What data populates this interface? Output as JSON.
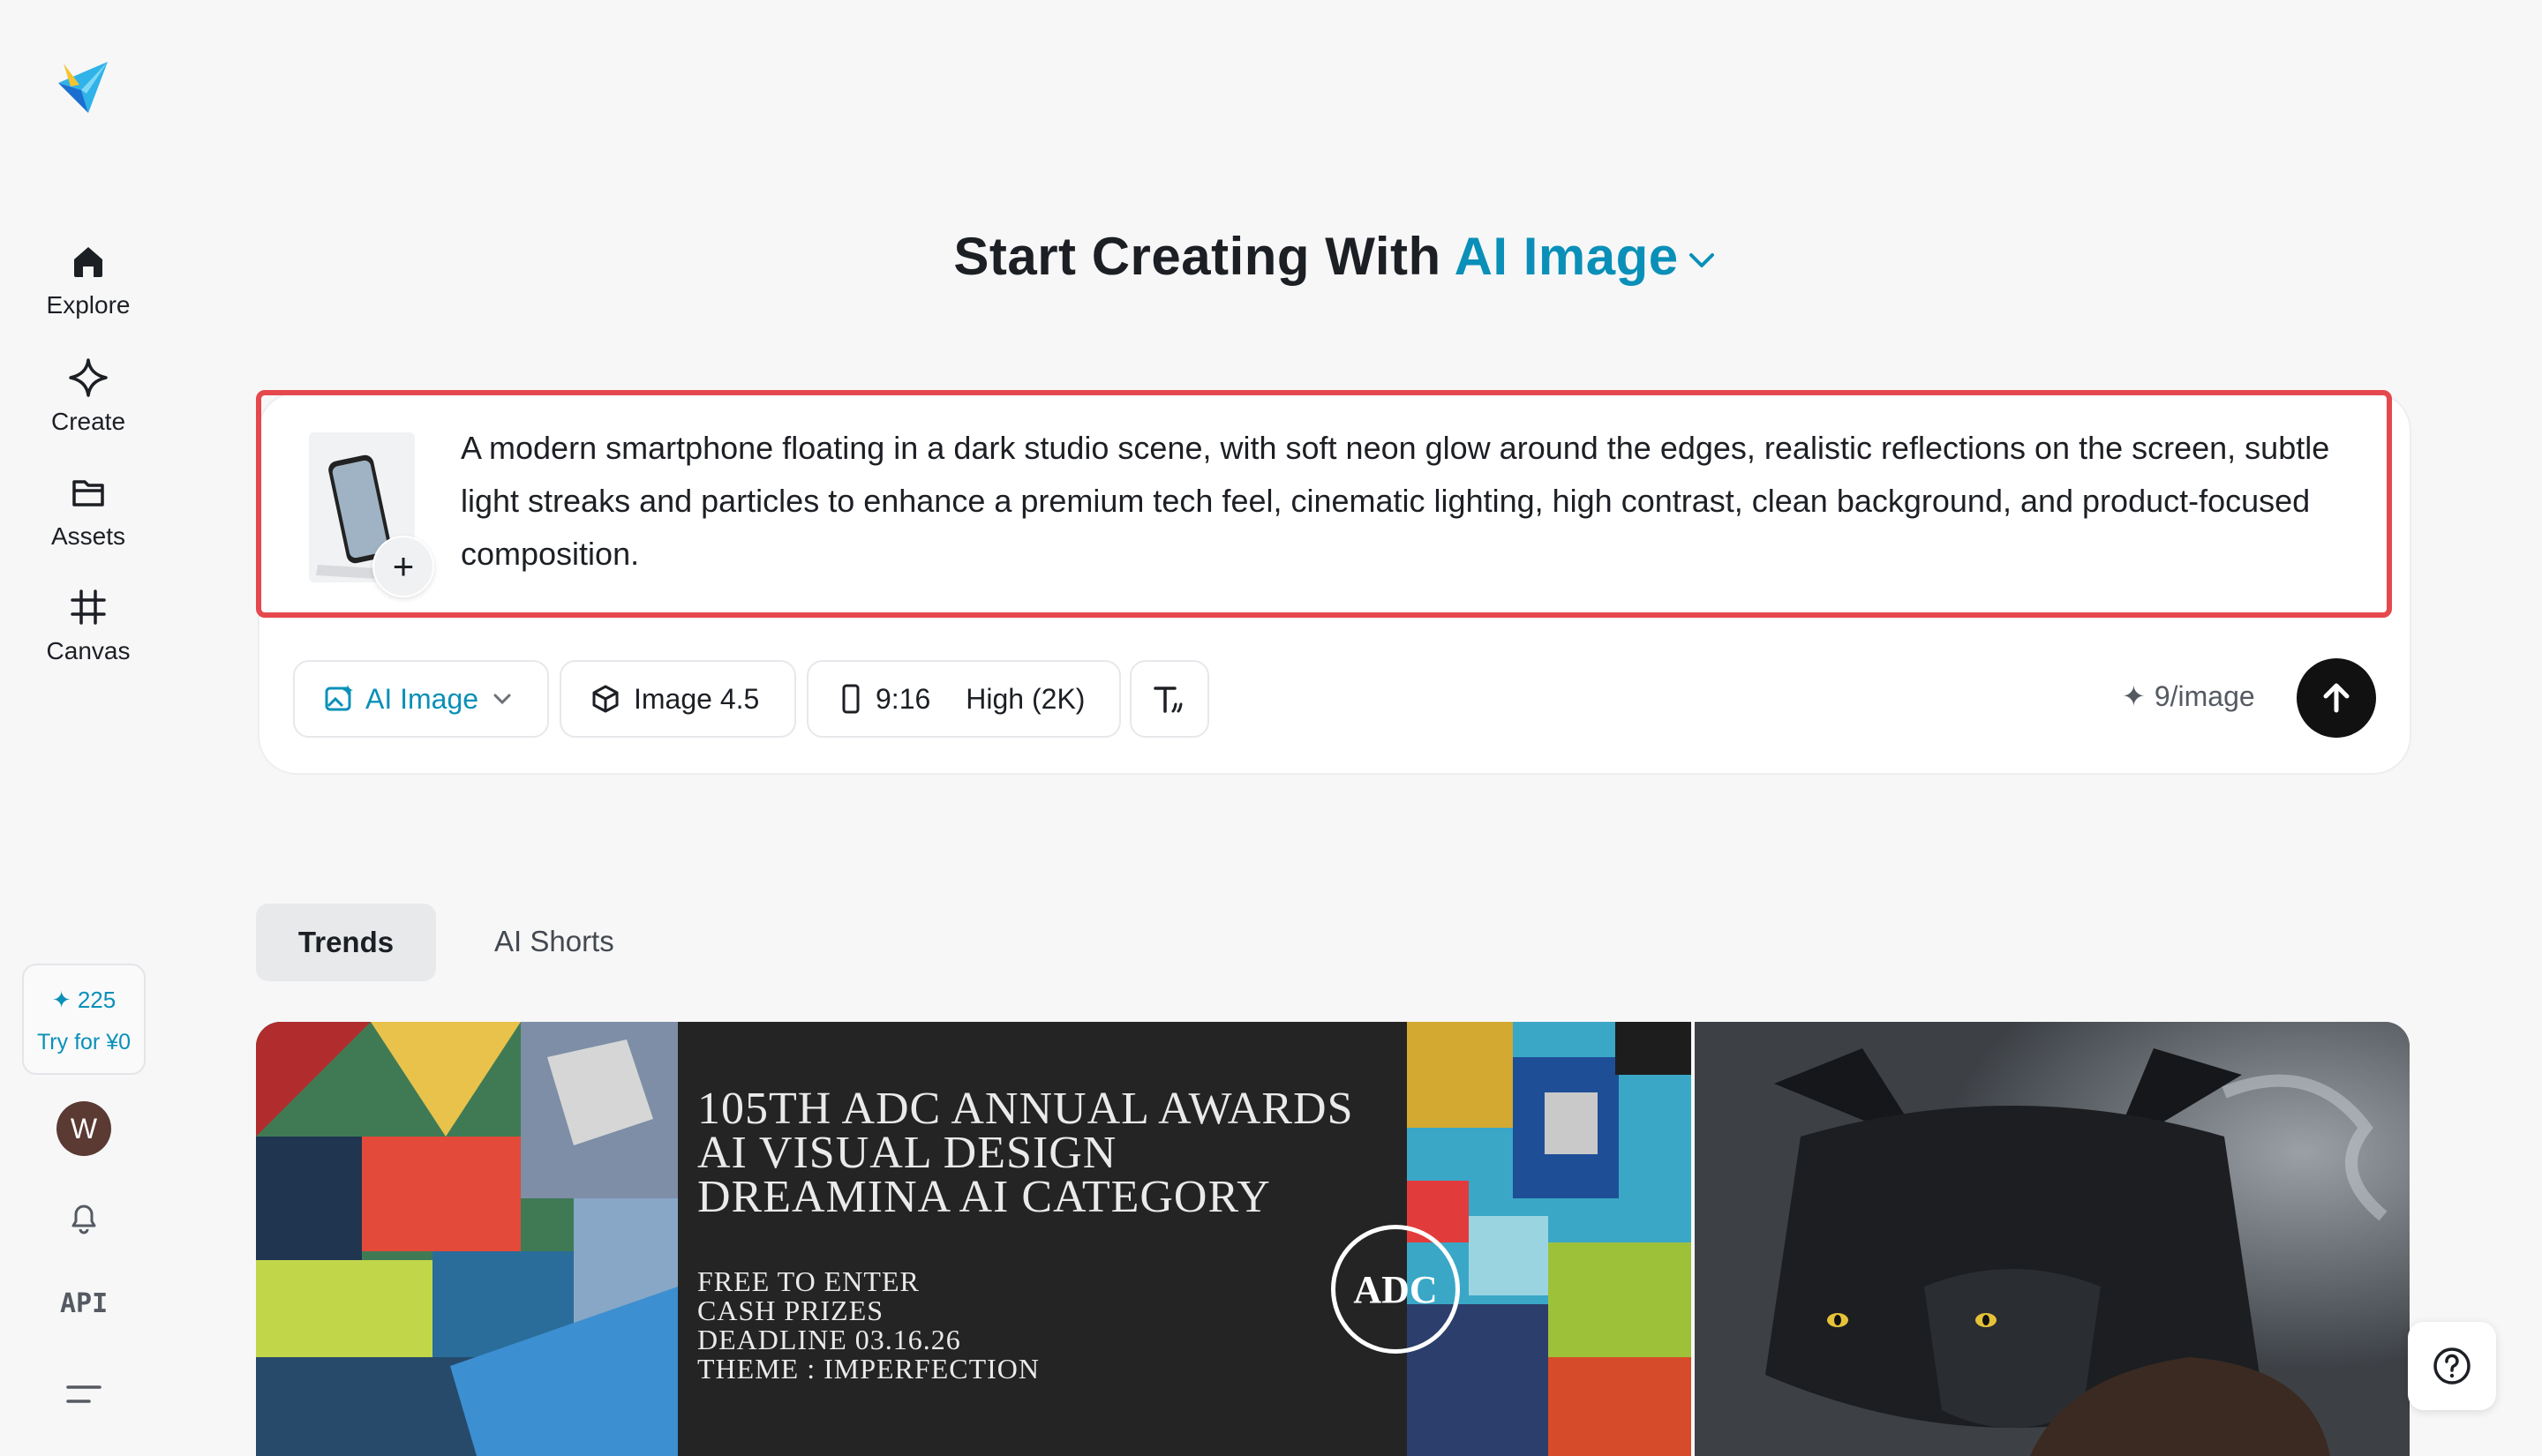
{
  "sidebar": {
    "nav": [
      {
        "label": "Explore",
        "icon": "home-icon"
      },
      {
        "label": "Create",
        "icon": "sparkle-outline-icon"
      },
      {
        "label": "Assets",
        "icon": "folder-icon"
      },
      {
        "label": "Canvas",
        "icon": "canvas-grid-icon"
      }
    ],
    "credits": {
      "count": "225",
      "cta": "Try for ¥0"
    },
    "avatar_initial": "W",
    "api_label": "API"
  },
  "header": {
    "title_prefix": "Start Creating With",
    "title_accent": "AI Image"
  },
  "composer": {
    "prompt": "A modern smartphone floating in a dark studio scene, with soft neon glow around the edges, realistic reflections on the screen, subtle light streaks and particles to enhance a premium tech feel, cinematic lighting, high contrast, clean background, and product-focused composition.",
    "add_label": "+",
    "mode_label": "AI Image",
    "model_label": "Image 4.5",
    "ratio_label": "9:16",
    "quality_label": "High (2K)",
    "price_label": "9/image"
  },
  "tabs": [
    {
      "label": "Trends"
    },
    {
      "label": "AI Shorts"
    }
  ],
  "feed": {
    "poster": {
      "line1": "105TH ADC ANNUAL AWARDS",
      "line2": "AI VISUAL DESIGN",
      "line3": "DREAMINA AI CATEGORY",
      "sub1": "FREE TO ENTER",
      "sub2": "CASH PRIZES",
      "sub3": "DEADLINE 03.16.26",
      "sub4": "THEME : IMPERFECTION",
      "logo_text": "ADC"
    }
  },
  "colors": {
    "accent": "#0a90b8",
    "highlight": "#e5484d"
  }
}
